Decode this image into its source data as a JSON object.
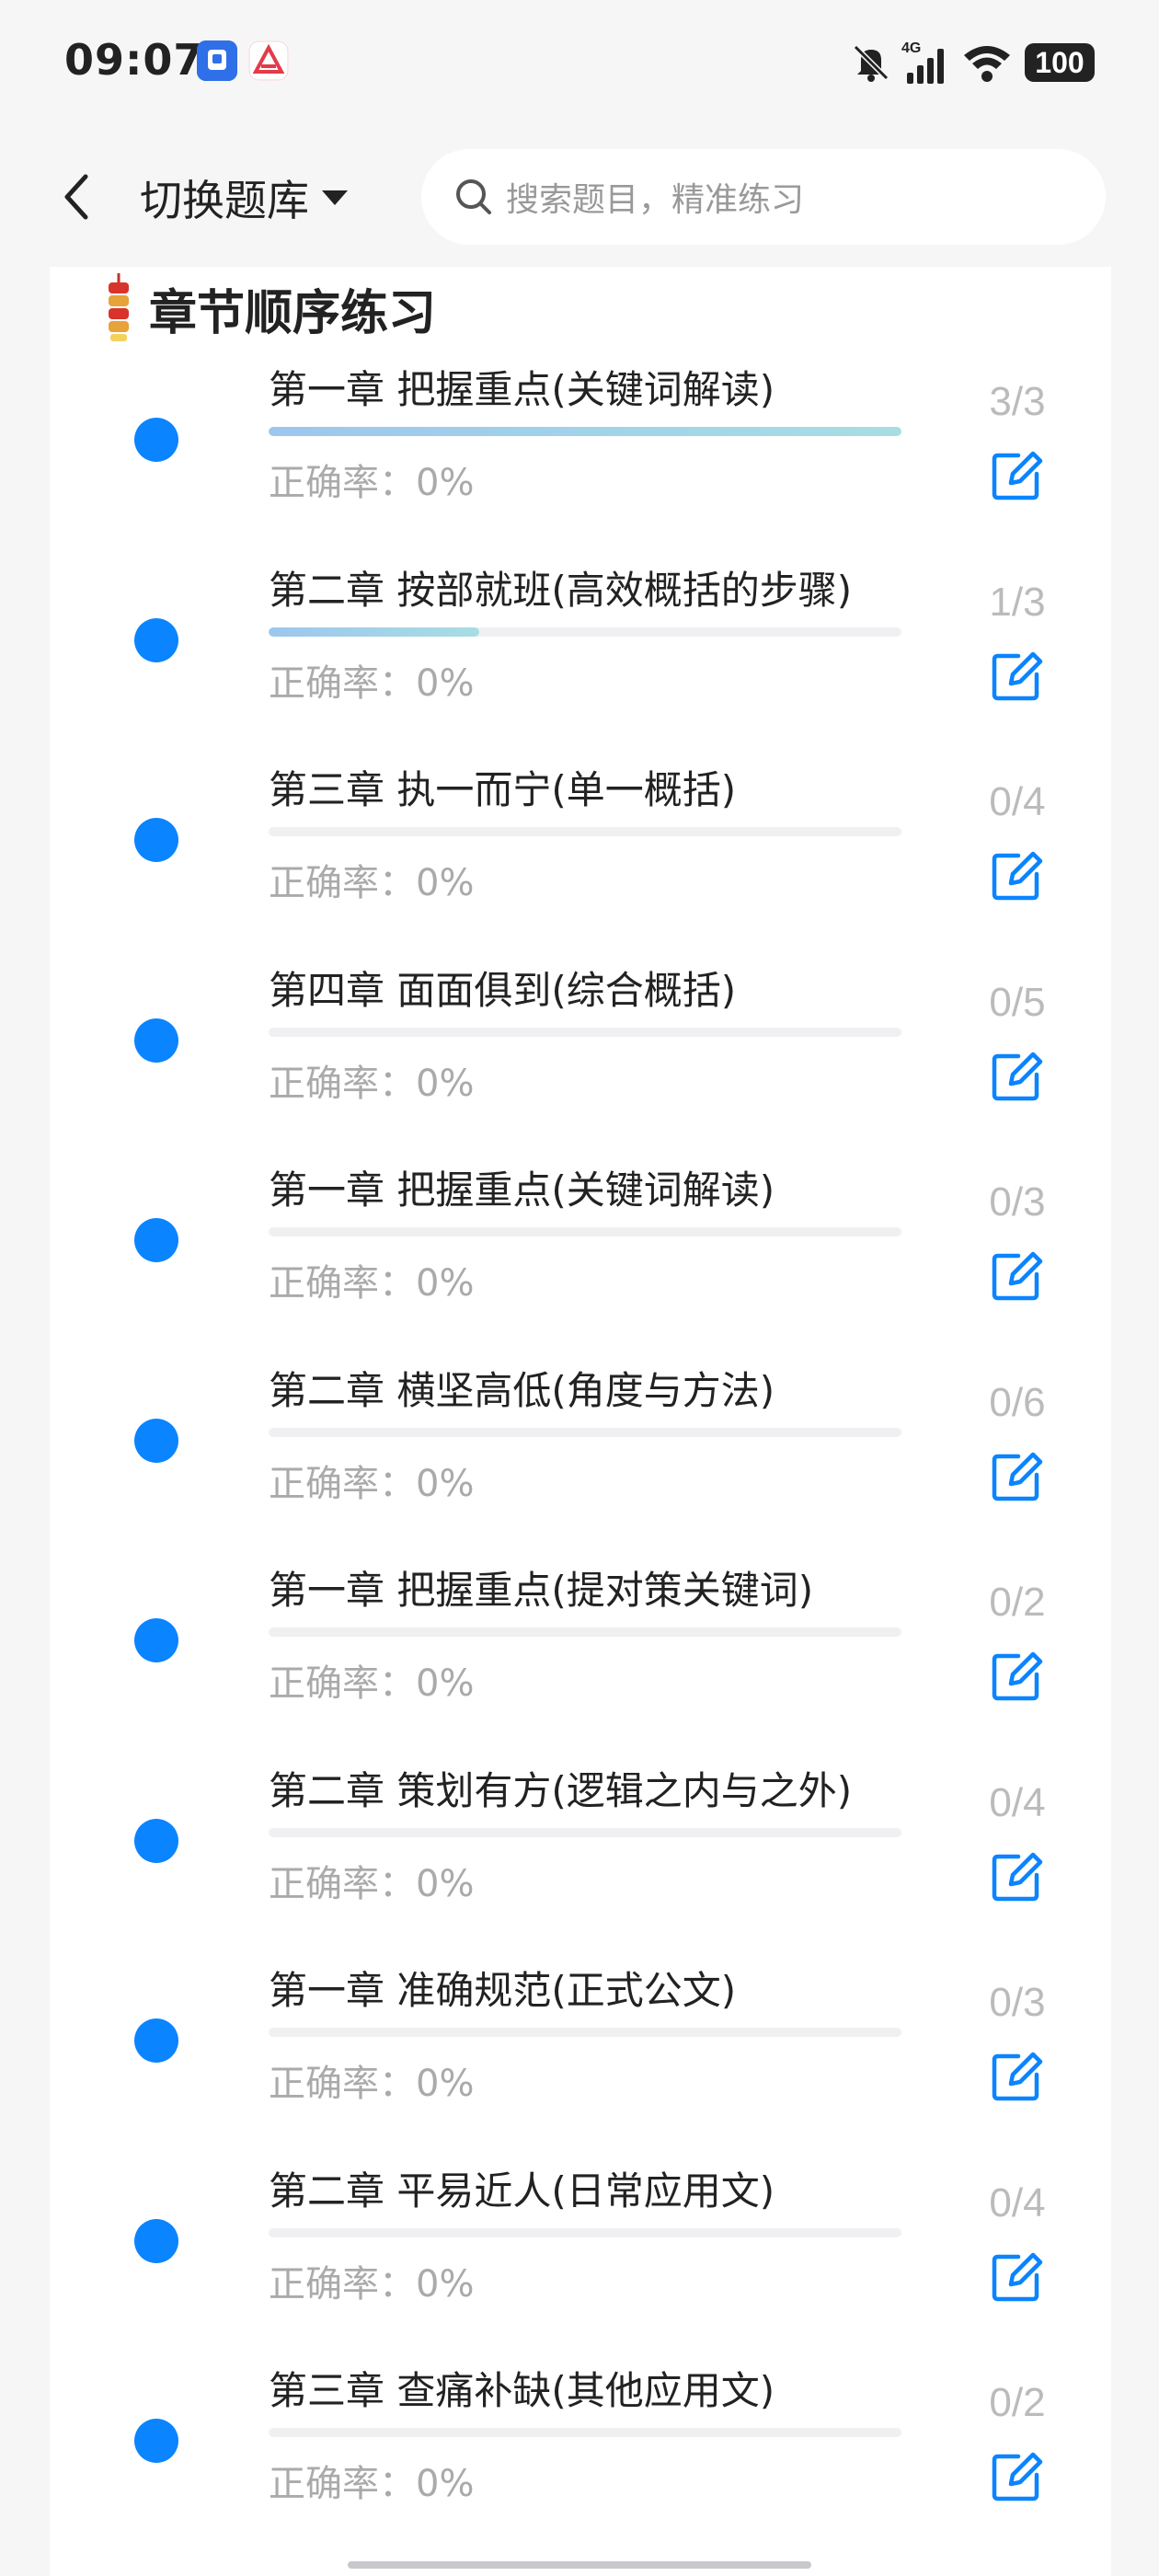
{
  "status_bar": {
    "time": "09:07",
    "battery": "100",
    "network": "4G",
    "icons": [
      "bell-muted-icon",
      "signal-icon",
      "wifi-icon",
      "battery-icon"
    ]
  },
  "header": {
    "title": "切换题库",
    "search_placeholder": "搜索题目，精准练习"
  },
  "section": {
    "title": "章节顺序练习",
    "icon": "firecracker-icon"
  },
  "accent_color": "#0a84ff",
  "chapters": [
    {
      "title": "第一章 把握重点(关键词解读)",
      "accuracy": "正确率：0%",
      "count": "3/3",
      "progress": 1.0
    },
    {
      "title": "第二章 按部就班(高效概括的步骤)",
      "accuracy": "正确率：0%",
      "count": "1/3",
      "progress": 0.333
    },
    {
      "title": "第三章 执一而宁(单一概括)",
      "accuracy": "正确率：0%",
      "count": "0/4",
      "progress": 0
    },
    {
      "title": "第四章 面面俱到(综合概括)",
      "accuracy": "正确率：0%",
      "count": "0/5",
      "progress": 0
    },
    {
      "title": "第一章 把握重点(关键词解读)",
      "accuracy": "正确率：0%",
      "count": "0/3",
      "progress": 0
    },
    {
      "title": "第二章 横坚高低(角度与方法)",
      "accuracy": "正确率：0%",
      "count": "0/6",
      "progress": 0
    },
    {
      "title": "第一章 把握重点(提对策关键词)",
      "accuracy": "正确率：0%",
      "count": "0/2",
      "progress": 0
    },
    {
      "title": "第二章 策划有方(逻辑之内与之外)",
      "accuracy": "正确率：0%",
      "count": "0/4",
      "progress": 0
    },
    {
      "title": "第一章 准确规范(正式公文)",
      "accuracy": "正确率：0%",
      "count": "0/3",
      "progress": 0
    },
    {
      "title": "第二章 平易近人(日常应用文)",
      "accuracy": "正确率：0%",
      "count": "0/4",
      "progress": 0
    },
    {
      "title": "第三章 查痛补缺(其他应用文)",
      "accuracy": "正确率：0%",
      "count": "0/2",
      "progress": 0
    }
  ]
}
